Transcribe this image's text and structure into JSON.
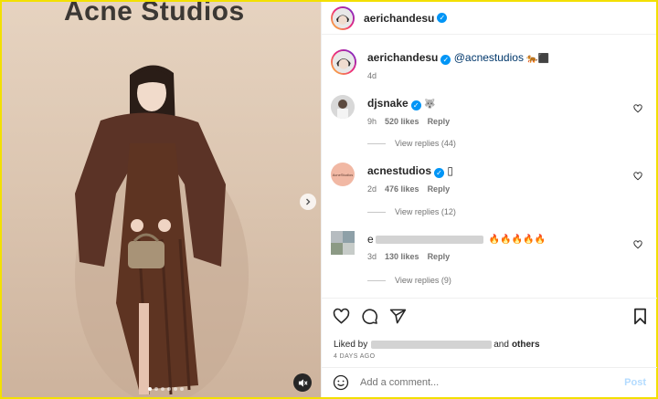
{
  "photo": {
    "brand_text": "Acne Studios",
    "slide_count": 6,
    "active_slide": 1,
    "icons": {
      "next": "chevron-right-icon",
      "mute": "speaker-muted-icon"
    }
  },
  "header": {
    "username": "aerichandesu",
    "verified": true
  },
  "caption": {
    "username": "aerichandesu",
    "mention": "@acnestudios",
    "emoji": "🐅⬛",
    "time": "4d"
  },
  "comments": [
    {
      "username": "djsnake",
      "verified": true,
      "text": "🐺",
      "time": "9h",
      "likes": "520 likes",
      "reply": "Reply",
      "view_replies": "View replies (44)"
    },
    {
      "username": "acnestudios",
      "verified": true,
      "text": "▯",
      "time": "2d",
      "likes": "476 likes",
      "reply": "Reply",
      "view_replies": "View replies (12)",
      "avatar_text": "AcneStudios"
    },
    {
      "username": "e",
      "verified": false,
      "text": "🔥🔥🔥🔥🔥",
      "time": "3d",
      "likes": "130 likes",
      "reply": "Reply",
      "view_replies": "View replies (9)"
    }
  ],
  "actions": {
    "icons": [
      "heart-icon",
      "comment-icon",
      "share-icon",
      "bookmark-icon"
    ]
  },
  "likes_line": {
    "prefix": "Liked by",
    "suffix": "and",
    "others": "others"
  },
  "date": "4 DAYS AGO",
  "add_comment": {
    "placeholder": "Add a comment...",
    "post_label": "Post"
  },
  "colors": {
    "accent": "#0095f6",
    "frame": "#f3e000",
    "fire": "#ff5a1f"
  }
}
